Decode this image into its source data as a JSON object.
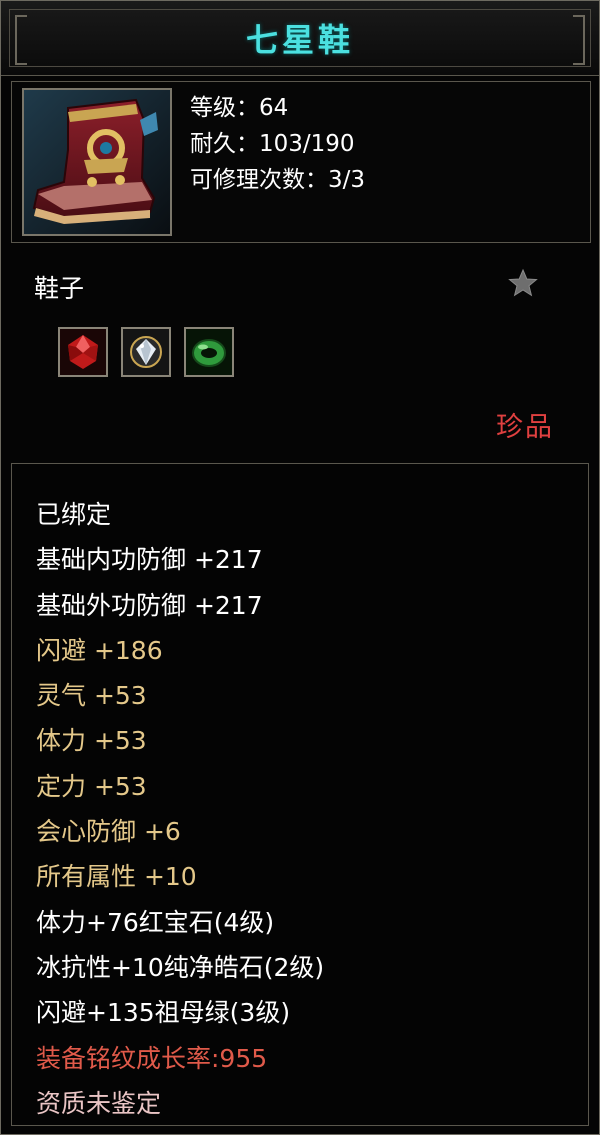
{
  "item": {
    "name": "七星鞋",
    "level_label": "等级：64",
    "durability_label": "耐久：103/190",
    "repair_label": "可修理次数：3/3",
    "type": "鞋子",
    "rarity": "珍品",
    "gems": [
      {
        "name": "red-gem",
        "color": "#c01a1a"
      },
      {
        "name": "diamond-gem",
        "color": "#d8dee6"
      },
      {
        "name": "jade-gem",
        "color": "#2f9a3c"
      }
    ]
  },
  "properties": [
    {
      "text": "已绑定",
      "color": "white"
    },
    {
      "text": "基础内功防御  +217",
      "color": "white"
    },
    {
      "text": "基础外功防御  +217",
      "color": "white"
    },
    {
      "text": "闪避  +186",
      "color": "gold"
    },
    {
      "text": "灵气  +53",
      "color": "gold"
    },
    {
      "text": "体力  +53",
      "color": "gold"
    },
    {
      "text": "定力  +53",
      "color": "gold"
    },
    {
      "text": "会心防御  +6",
      "color": "gold"
    },
    {
      "text": "所有属性  +10",
      "color": "gold"
    },
    {
      "text": "体力+76红宝石(4级)",
      "color": "white"
    },
    {
      "text": "冰抗性+10纯净皓石(2级)",
      "color": "white"
    },
    {
      "text": "闪避+135祖母绿(3级)",
      "color": "white"
    },
    {
      "text": "装备铭纹成长率:955",
      "color": "red"
    },
    {
      "text": "资质未鉴定",
      "color": "pink"
    }
  ],
  "colors": {
    "title": "#4be0e0",
    "gold": "#e4c88a",
    "red": "#e05a4a",
    "pink": "#eac5c5",
    "rarity": "#e04040"
  }
}
